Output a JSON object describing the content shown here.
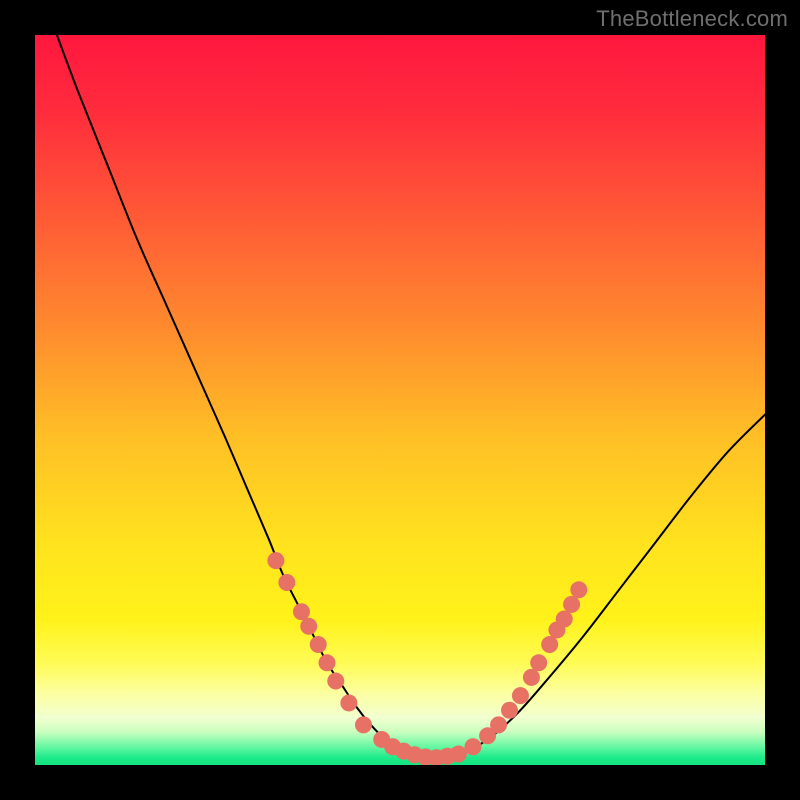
{
  "watermark": "TheBottleneck.com",
  "colors": {
    "bg": "#000000",
    "curve": "#000000",
    "dot_fill": "#e77165",
    "dot_stroke": "#d95a4f",
    "gradient_stops": [
      {
        "offset": 0.0,
        "color": "#ff173e"
      },
      {
        "offset": 0.1,
        "color": "#ff2b3d"
      },
      {
        "offset": 0.25,
        "color": "#ff5a36"
      },
      {
        "offset": 0.4,
        "color": "#ff8a2e"
      },
      {
        "offset": 0.55,
        "color": "#ffbf26"
      },
      {
        "offset": 0.7,
        "color": "#ffe31e"
      },
      {
        "offset": 0.8,
        "color": "#fff21a"
      },
      {
        "offset": 0.86,
        "color": "#fffb55"
      },
      {
        "offset": 0.9,
        "color": "#fcff9e"
      },
      {
        "offset": 0.935,
        "color": "#f2ffd0"
      },
      {
        "offset": 0.955,
        "color": "#c8ffbe"
      },
      {
        "offset": 0.975,
        "color": "#66f7a2"
      },
      {
        "offset": 0.99,
        "color": "#1ceb8a"
      },
      {
        "offset": 1.0,
        "color": "#14e37e"
      }
    ]
  },
  "chart_data": {
    "type": "line",
    "title": "",
    "xlabel": "",
    "ylabel": "",
    "xlim": [
      0,
      100
    ],
    "ylim": [
      0,
      100
    ],
    "series": [
      {
        "name": "bottleneck-curve",
        "x": [
          3,
          6,
          10,
          14,
          18,
          22,
          26,
          29,
          32,
          34,
          36,
          38,
          40,
          42,
          44,
          46,
          48,
          50,
          52,
          55,
          58,
          62,
          66,
          70,
          75,
          80,
          85,
          90,
          95,
          100
        ],
        "y": [
          100,
          92,
          82,
          72,
          63,
          54,
          45,
          38,
          31,
          26,
          22,
          18,
          14,
          11,
          8,
          5.5,
          3.5,
          2.2,
          1.4,
          1.0,
          1.4,
          3.5,
          7.0,
          11.5,
          17.5,
          24.0,
          30.5,
          37.0,
          43.0,
          48.0
        ]
      }
    ],
    "points": [
      {
        "x": 33.0,
        "y": 28.0
      },
      {
        "x": 34.5,
        "y": 25.0
      },
      {
        "x": 36.5,
        "y": 21.0
      },
      {
        "x": 37.5,
        "y": 19.0
      },
      {
        "x": 38.8,
        "y": 16.5
      },
      {
        "x": 40.0,
        "y": 14.0
      },
      {
        "x": 41.2,
        "y": 11.5
      },
      {
        "x": 43.0,
        "y": 8.5
      },
      {
        "x": 45.0,
        "y": 5.5
      },
      {
        "x": 47.5,
        "y": 3.5
      },
      {
        "x": 49.0,
        "y": 2.5
      },
      {
        "x": 50.5,
        "y": 1.9
      },
      {
        "x": 52.0,
        "y": 1.4
      },
      {
        "x": 53.5,
        "y": 1.1
      },
      {
        "x": 55.0,
        "y": 1.0
      },
      {
        "x": 56.5,
        "y": 1.2
      },
      {
        "x": 58.0,
        "y": 1.5
      },
      {
        "x": 60.0,
        "y": 2.5
      },
      {
        "x": 62.0,
        "y": 4.0
      },
      {
        "x": 63.5,
        "y": 5.5
      },
      {
        "x": 65.0,
        "y": 7.5
      },
      {
        "x": 66.5,
        "y": 9.5
      },
      {
        "x": 68.0,
        "y": 12.0
      },
      {
        "x": 69.0,
        "y": 14.0
      },
      {
        "x": 70.5,
        "y": 16.5
      },
      {
        "x": 71.5,
        "y": 18.5
      },
      {
        "x": 72.5,
        "y": 20.0
      },
      {
        "x": 73.5,
        "y": 22.0
      },
      {
        "x": 74.5,
        "y": 24.0
      }
    ]
  }
}
